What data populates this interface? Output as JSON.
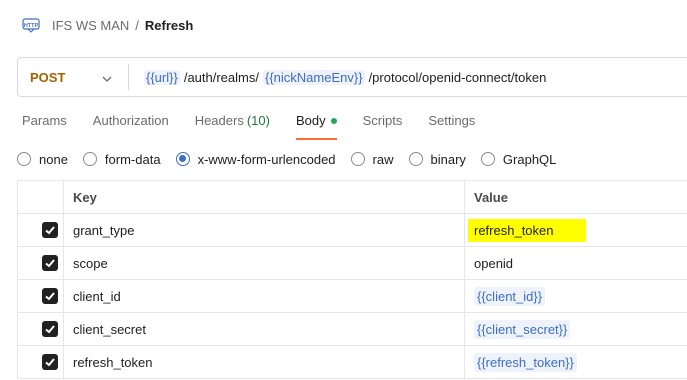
{
  "breadcrumb": {
    "icon": "http-icon",
    "collection": "IFS WS MAN",
    "separator": "/",
    "request": "Refresh"
  },
  "request": {
    "method": "POST",
    "url_parts": {
      "var1": "{{url}}",
      "part1": "/auth/realms/",
      "var2": "{{nickNameEnv}}",
      "part2": "/protocol/openid-connect/token"
    }
  },
  "tabs": {
    "params": "Params",
    "authorization": "Authorization",
    "headers": "Headers",
    "headers_count": "(10)",
    "body": "Body",
    "scripts": "Scripts",
    "settings": "Settings",
    "active": "Body"
  },
  "body_types": {
    "none": "none",
    "form_data": "form-data",
    "urlencoded": "x-www-form-urlencoded",
    "raw": "raw",
    "binary": "binary",
    "graphql": "GraphQL",
    "selected": "x-www-form-urlencoded"
  },
  "table": {
    "key_header": "Key",
    "value_header": "Value",
    "rows": [
      {
        "key": "grant_type",
        "value": "refresh_token",
        "checked": true
      },
      {
        "key": "scope",
        "value": "openid",
        "checked": true
      },
      {
        "key": "client_id",
        "value": "{{client_id}}",
        "checked": true
      },
      {
        "key": "client_secret",
        "value": "{{client_secret}}",
        "checked": true
      },
      {
        "key": "refresh_token",
        "value": "{{refresh_token}}",
        "checked": true
      }
    ]
  },
  "colors": {
    "method_post": "#a36200",
    "variable": "#3d6ec2",
    "active_tab_underline": "#ff6c37",
    "body_dot": "#27a35a",
    "highlight": "#ffff00"
  }
}
